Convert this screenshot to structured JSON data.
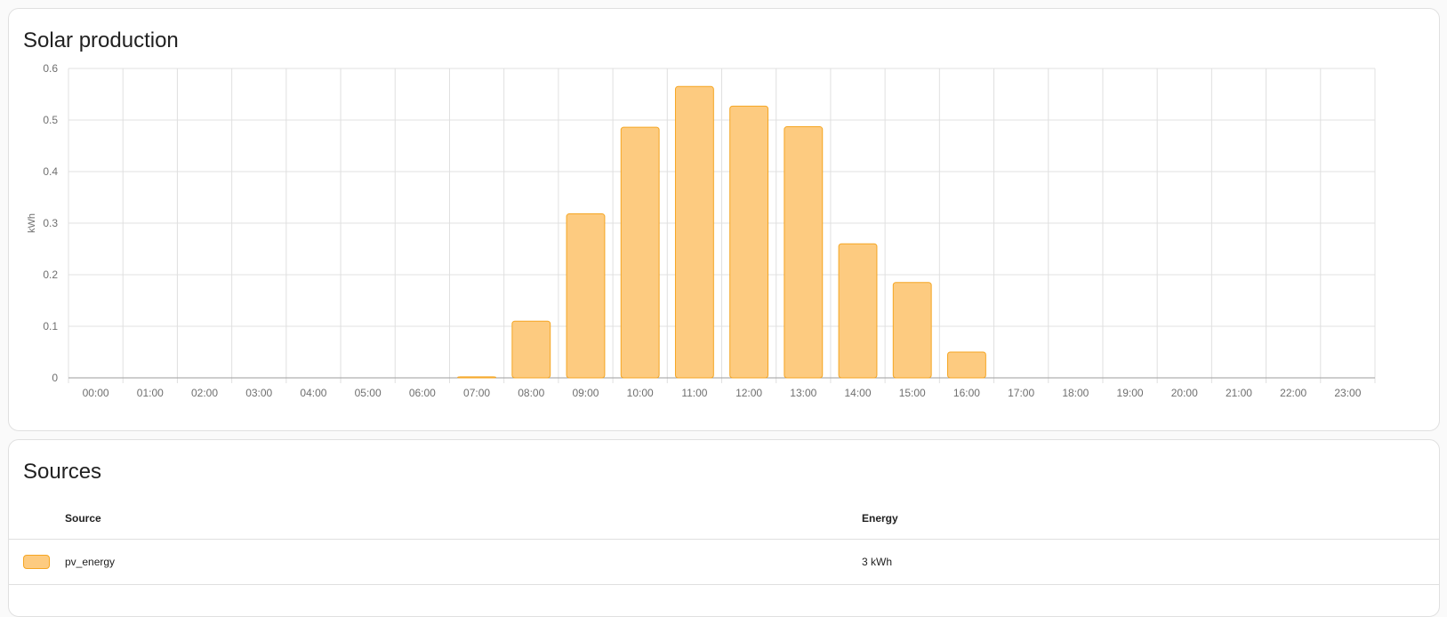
{
  "solar_card": {
    "title": "Solar production"
  },
  "chart_data": {
    "type": "bar",
    "title": "Solar production",
    "xlabel": "",
    "ylabel": "kWh",
    "categories": [
      "00:00",
      "01:00",
      "02:00",
      "03:00",
      "04:00",
      "05:00",
      "06:00",
      "07:00",
      "08:00",
      "09:00",
      "10:00",
      "11:00",
      "12:00",
      "13:00",
      "14:00",
      "15:00",
      "16:00",
      "17:00",
      "18:00",
      "19:00",
      "20:00",
      "21:00",
      "22:00",
      "23:00"
    ],
    "series": [
      {
        "name": "pv_energy",
        "values": [
          0,
          0,
          0,
          0,
          0,
          0,
          0,
          0.002,
          0.11,
          0.318,
          0.486,
          0.565,
          0.527,
          0.487,
          0.26,
          0.185,
          0.05,
          0,
          0,
          0,
          0,
          0,
          0,
          0
        ]
      }
    ],
    "ylim": [
      0,
      0.6
    ],
    "yticks": [
      0,
      0.1,
      0.2,
      0.3,
      0.4,
      0.5,
      0.6
    ],
    "ytick_labels": [
      "0",
      "0.1",
      "0.2",
      "0.3",
      "0.4",
      "0.5",
      "0.6"
    ],
    "grid": true,
    "colors": {
      "bar_fill": "#fdcb80",
      "bar_stroke": "#f5a623",
      "grid": "#e0e0e0"
    }
  },
  "sources_card": {
    "title": "Sources",
    "columns": {
      "source": "Source",
      "energy": "Energy"
    },
    "rows": [
      {
        "source": "pv_energy",
        "energy": "3 kWh",
        "color": "#fdcb80",
        "border_color": "#f5a623"
      }
    ]
  }
}
